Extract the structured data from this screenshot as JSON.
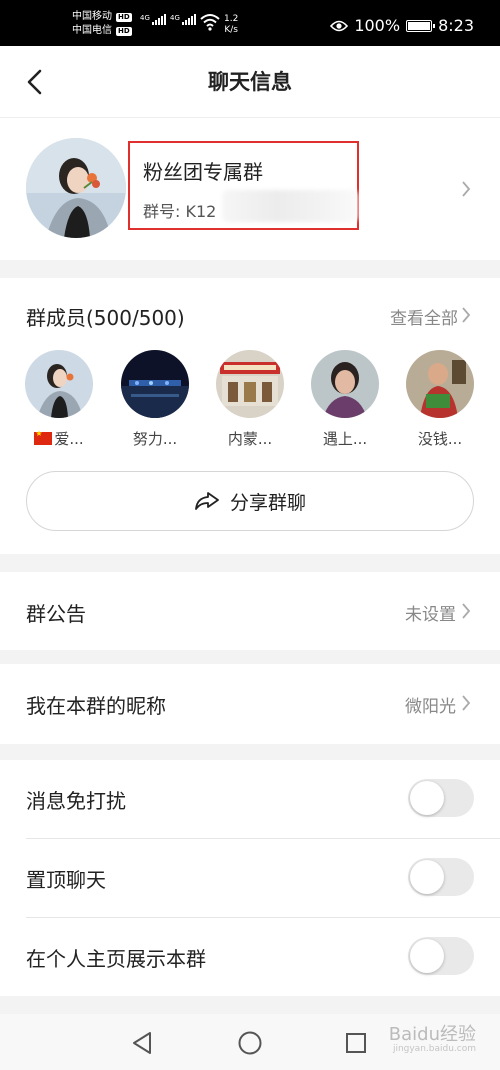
{
  "status_bar": {
    "carrier1": "中国移动",
    "carrier2": "中国电信",
    "hd_label": "HD",
    "network": "4G",
    "speed_value": "1.2",
    "speed_unit": "K/s",
    "battery": "100%",
    "time": "8:23"
  },
  "header": {
    "title": "聊天信息"
  },
  "group": {
    "name": "粉丝团专属群",
    "id_text": "群号: K12"
  },
  "members": {
    "title": "群成员(500/500)",
    "see_all": "查看全部",
    "list": [
      {
        "name": "爱..."
      },
      {
        "name": "努力..."
      },
      {
        "name": "内蒙..."
      },
      {
        "name": "遇上..."
      },
      {
        "name": "没钱..."
      }
    ],
    "share_label": "分享群聊"
  },
  "notice": {
    "label": "群公告",
    "value": "未设置"
  },
  "nickname": {
    "label": "我在本群的昵称",
    "value": "微阳光"
  },
  "toggles": [
    {
      "label": "消息免打扰",
      "on": false
    },
    {
      "label": "置顶聊天",
      "on": false
    },
    {
      "label": "在个人主页展示本群",
      "on": false
    }
  ],
  "watermark": {
    "main": "Baidu经验",
    "sub": "jingyan.baidu.com"
  },
  "colors": {
    "highlight": "#e0302e",
    "toggle_off": "#e9e9e9"
  }
}
